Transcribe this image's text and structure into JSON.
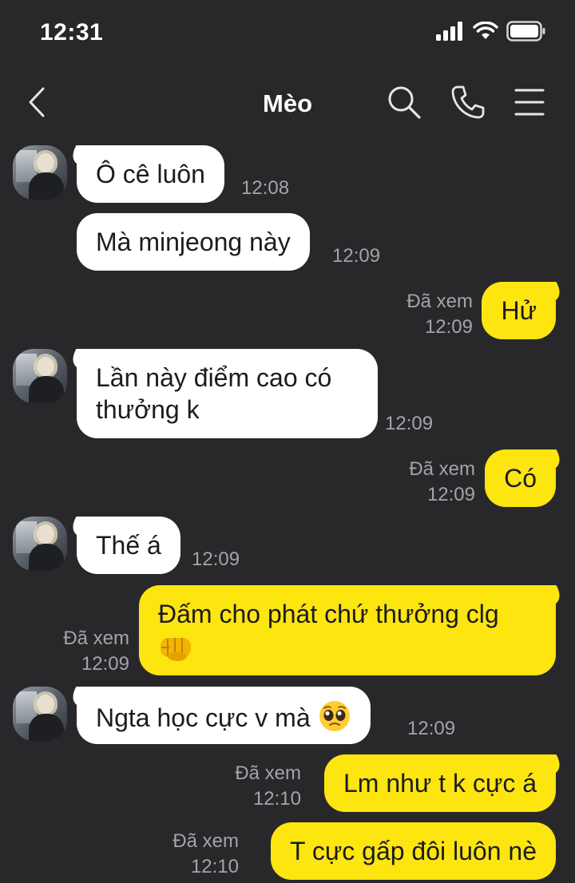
{
  "status_bar": {
    "time": "12:31"
  },
  "header": {
    "title": "Mèo"
  },
  "messages": [
    {
      "side": "in",
      "text": "Ô cê luôn",
      "time": "12:08"
    },
    {
      "side": "in",
      "text": "Mà minjeong này",
      "time": "12:09"
    },
    {
      "side": "out",
      "text": "Hử",
      "seen": "Đã xem",
      "time": "12:09"
    },
    {
      "side": "in",
      "text": "Lần này điểm cao có thưởng k",
      "time": "12:09"
    },
    {
      "side": "out",
      "text": "Có",
      "seen": "Đã xem",
      "time": "12:09"
    },
    {
      "side": "in",
      "text": "Thế á",
      "time": "12:09"
    },
    {
      "side": "out",
      "text": "Đấm cho phát chứ thưởng clg",
      "emoji": "fist-emoji",
      "seen": "Đã xem",
      "time": "12:09"
    },
    {
      "side": "in",
      "text": "Ngta học cực v mà",
      "emoji": "pleading-face-emoji",
      "time": "12:09"
    },
    {
      "side": "out",
      "text": "Lm như t k cực á",
      "seen": "Đã xem",
      "time": "12:10"
    },
    {
      "side": "out",
      "text": "T cực gấp đôi luôn nè",
      "seen": "Đã xem",
      "time": "12:10"
    }
  ],
  "icons": {
    "back": "chevron-left-icon",
    "search": "search-icon",
    "call": "phone-icon",
    "menu": "menu-icon",
    "signal": "signal-icon",
    "wifi": "wifi-icon",
    "battery": "battery-icon"
  },
  "colors": {
    "background": "#28282b",
    "incoming_bubble": "#ffffff",
    "outgoing_bubble": "#fde510",
    "meta_text": "#a4a4a8"
  }
}
